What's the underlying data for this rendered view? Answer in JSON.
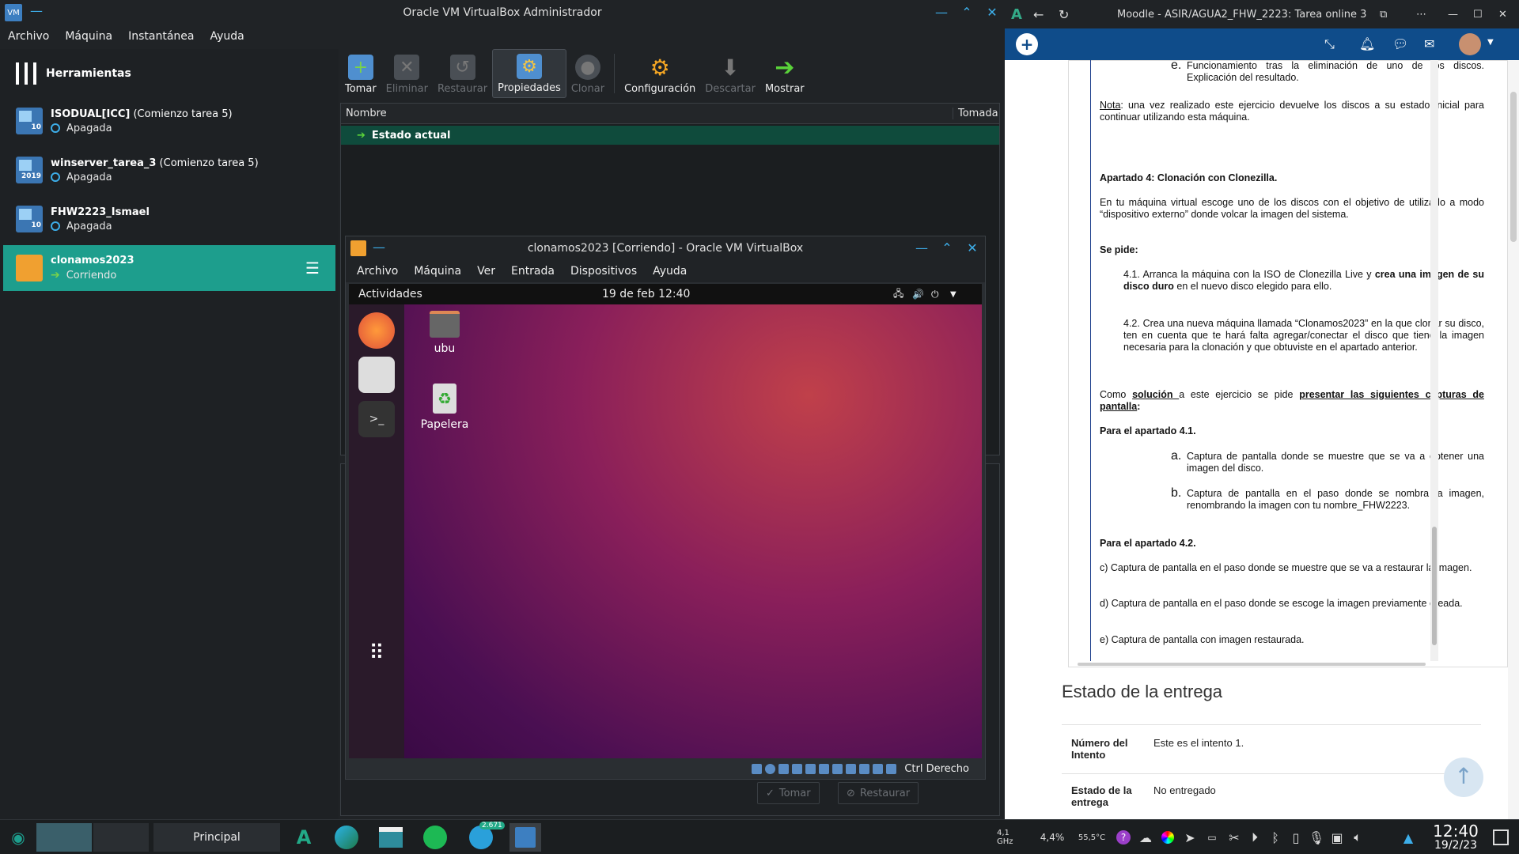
{
  "vbox": {
    "title": "Oracle VM VirtualBox Administrador",
    "menu": [
      "Archivo",
      "Máquina",
      "Instantánea",
      "Ayuda"
    ],
    "tools_label": "Herramientas",
    "vms": [
      {
        "name": "ISODUAL[ICC]",
        "suffix": " (Comienzo tarea 5)",
        "state": "Apagada",
        "badge": "10"
      },
      {
        "name": "winserver_tarea_3",
        "suffix": " (Comienzo tarea 5)",
        "state": "Apagada",
        "badge": "2019"
      },
      {
        "name": "FHW2223_Ismael",
        "suffix": "",
        "state": "Apagada",
        "badge": "10"
      },
      {
        "name": "clonamos2023",
        "suffix": "",
        "state": "Corriendo",
        "badge": ""
      }
    ],
    "toolbar": {
      "take": "Tomar",
      "delete": "Eliminar",
      "restore": "Restaurar",
      "properties": "Propiedades",
      "clone": "Clonar",
      "config": "Configuración",
      "discard": "Descartar",
      "show": "Mostrar"
    },
    "snap_cols": {
      "name": "Nombre",
      "taken": "Tomada"
    },
    "snap_current": "Estado actual",
    "lower_take": "Tomar",
    "lower_restore": "Restaurar"
  },
  "vmwin": {
    "title": "clonamos2023 [Corriendo] - Oracle VM VirtualBox",
    "menu": [
      "Archivo",
      "Máquina",
      "Ver",
      "Entrada",
      "Dispositivos",
      "Ayuda"
    ],
    "activities": "Actividades",
    "clock": "19 de feb  12:40",
    "home_label": "ubu",
    "trash_label": "Papelera",
    "host_key": "Ctrl Derecho"
  },
  "browser": {
    "title": "Moodle - ASIR/AGUA2_FHW_2223: Tarea online 3",
    "item_e": "Funcionamiento tras la eliminación de uno de los discos. Explicación del resultado.",
    "nota_label": "Nota",
    "nota_text": ": una vez realizado este ejercicio devuelve los discos a su estado inicial para continuar utilizando esta máquina.",
    "apartado4": "Apartado 4: Clonación con Clonezilla.",
    "p_intro": "En tu máquina virtual escoge uno de los discos con el objetivo de utilizarlo a modo “dispositivo externo” donde volcar la imagen del sistema.",
    "se_pide": "Se pide:",
    "p41_a": "4.1. Arranca la máquina con la ISO de Clonezilla Live y ",
    "p41_b": "crea una imagen de su disco duro",
    "p41_c": " en el nuevo disco elegido para ello.",
    "p42": "4.2. Crea una nueva máquina llamada “Clonamos2023” en la que clonar su disco, ten en cuenta que te hará falta agregar/conectar el disco que tiene la imagen necesaria para la clonación y que obtuviste en el apartado anterior.",
    "como_a": "Como ",
    "como_b": "solución ",
    "como_c": "a este ejercicio se pide ",
    "como_d": "presentar las siguientes capturas de pantalla",
    "como_e": ":",
    "para41": "Para el apartado 4.1.",
    "a_text": "Captura de pantalla donde se muestre que se va a obtener una imagen del disco.",
    "b_text": "Captura de pantalla en el paso donde se nombra la imagen, renombrando la imagen con tu nombre_FHW2223.",
    "para42": "Para el apartado 4.2.",
    "c_text": "c) Captura de pantalla en el paso donde se muestre que se va a restaurar la imagen.",
    "d_text": "d) Captura de pantalla en el paso donde se escoge la imagen previamente creada.",
    "e_text": "e) Captura de pantalla con imagen restaurada.",
    "estado_title": "Estado de la entrega",
    "row1_label": "Número del Intento",
    "row1_value": "Este es el intento 1.",
    "row2_label": "Estado de la entrega",
    "row2_value": "No entregado"
  },
  "taskbar": {
    "principal": "Principal",
    "badge": "2.671",
    "cpu": "4,1 GHz",
    "load": "4,4%",
    "temp": "55,5°C",
    "time": "12:40",
    "date": "19/2/23"
  },
  "colors": {
    "accent": "#1d9e8d",
    "kde_blue": "#3daee9",
    "moodle_blue": "#0f4c8a"
  }
}
